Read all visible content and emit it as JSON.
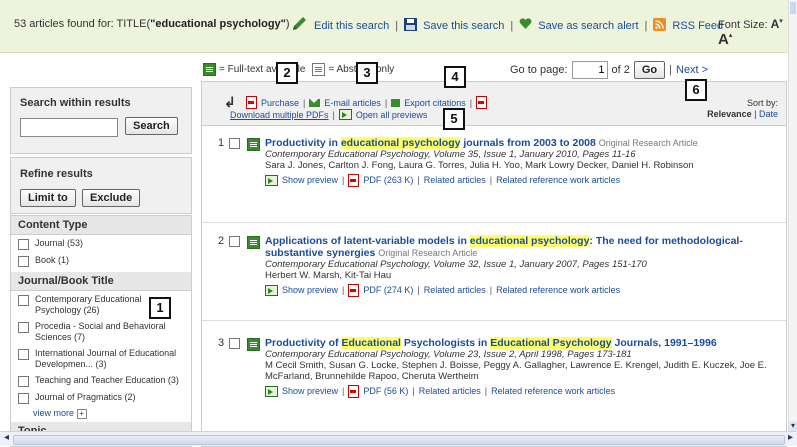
{
  "header": {
    "found_prefix": "53 articles found for: TITLE(",
    "found_query": "\"educational psychology\"",
    "found_suffix": ")",
    "edit_search": "Edit this search",
    "save_search": "Save this search",
    "save_alert": "Save as search alert",
    "rss": "RSS Feed",
    "font_size_label": "Font Size:",
    "font_small": "A",
    "font_big": "A"
  },
  "legend": {
    "fulltext": "= Full-text available",
    "abstract": "= Abstract only"
  },
  "paging": {
    "goto_label": "Go to page:",
    "current_page": "1",
    "of_label": "of 2",
    "go_button": "Go",
    "next": "Next >"
  },
  "sidebar": {
    "search_within_title": "Search within results",
    "search_button": "Search",
    "refine_title": "Refine results",
    "limit_button": "Limit to",
    "exclude_button": "Exclude",
    "content_type_header": "Content Type",
    "content_types": [
      "Journal (53)",
      "Book (1)"
    ],
    "journal_header": "Journal/Book Title",
    "journals": [
      "Contemporary Educational Psychology (26)",
      "Procedia - Social and Behavioral Sciences (7)",
      "International Journal of Educational Developmen... (3)",
      "Teaching and Teacher Education (3)",
      "Journal of Pragmatics (2)"
    ],
    "view_more": "view more",
    "topic_header": "Topic"
  },
  "toolbar": {
    "purchase": "Purchase",
    "email": "E-mail articles",
    "export": "Export citations",
    "download_pdfs": "Download multiple PDFs",
    "open_previews": "Open all previews",
    "sort_by": "Sort by:",
    "sort_relevance": "Relevance",
    "sort_date": "Date"
  },
  "articles": [
    {
      "num": "1",
      "title_pre": "Productivity in ",
      "title_hl": "educational psychology",
      "title_post": " journals from 2003 to 2008",
      "type": "Original Research Article",
      "journal": "Contemporary Educational Psychology, Volume 35, Issue 1, January 2010, Pages 11-16",
      "authors": "Sara J. Jones, Carlton J. Fong, Laura G. Torres, Julia H. Yoo, Mark Lowry Decker, Daniel H. Robinson",
      "preview": "Show preview",
      "pdf": "PDF (263 K)",
      "related": "Related articles",
      "related_ref": "Related reference work articles"
    },
    {
      "num": "2",
      "title_pre": "Applications of latent-variable models in ",
      "title_hl": "educational psychology",
      "title_post": ": The need for methodological-substantive synergies",
      "type": "Original Research Article",
      "journal": "Contemporary Educational Psychology, Volume 32, Issue 1, January 2007, Pages 151-170",
      "authors": "Herbert W. Marsh, Kit-Tai Hau",
      "preview": "Show preview",
      "pdf": "PDF (274 K)",
      "related": "Related articles",
      "related_ref": "Related reference work articles"
    },
    {
      "num": "3",
      "title_pre": "Productivity of ",
      "title_hl": "Educational",
      "title_mid": " Psychologists in ",
      "title_hl2": "Educational Psychology",
      "title_post": " Journals, 1991–1996",
      "type": "",
      "journal": "Contemporary Educational Psychology, Volume 23, Issue 2, April 1998, Pages 173-181",
      "authors": "M Cecil Smith, Susan G. Locke, Stephen J. Boisse, Peggy A. Gallagher, Lawrence E. Krengel, Judith E. Kuczek, Joe E. McFarland, Brunnehilde Rapoo, Cheruta Wertheim",
      "preview": "Show preview",
      "pdf": "PDF (56 K)",
      "related": "Related articles",
      "related_ref": "Related reference work articles"
    }
  ],
  "callouts": [
    "1",
    "2",
    "3",
    "4",
    "5",
    "6"
  ]
}
